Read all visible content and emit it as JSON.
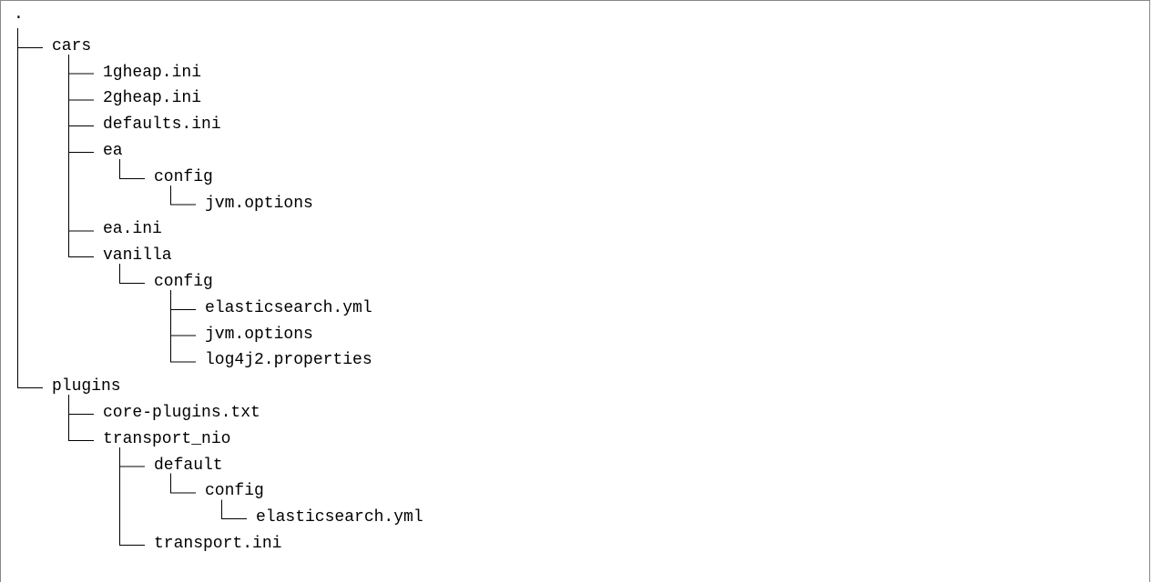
{
  "tree": {
    "root": ".",
    "nodes": [
      {
        "label": "cars",
        "depth": 1,
        "last": false
      },
      {
        "label": "1gheap.ini",
        "depth": 2,
        "last": false
      },
      {
        "label": "2gheap.ini",
        "depth": 2,
        "last": false
      },
      {
        "label": "defaults.ini",
        "depth": 2,
        "last": false
      },
      {
        "label": "ea",
        "depth": 2,
        "last": false
      },
      {
        "label": "config",
        "depth": 3,
        "last": true
      },
      {
        "label": "jvm.options",
        "depth": 4,
        "last": true
      },
      {
        "label": "ea.ini",
        "depth": 2,
        "last": false
      },
      {
        "label": "vanilla",
        "depth": 2,
        "last": true
      },
      {
        "label": "config",
        "depth": 3,
        "last": true
      },
      {
        "label": "elasticsearch.yml",
        "depth": 4,
        "last": false
      },
      {
        "label": "jvm.options",
        "depth": 4,
        "last": false
      },
      {
        "label": "log4j2.properties",
        "depth": 4,
        "last": true
      },
      {
        "label": "plugins",
        "depth": 1,
        "last": true
      },
      {
        "label": "core-plugins.txt",
        "depth": 2,
        "last": false
      },
      {
        "label": "transport_nio",
        "depth": 2,
        "last": true
      },
      {
        "label": "default",
        "depth": 3,
        "last": false
      },
      {
        "label": "config",
        "depth": 4,
        "last": true
      },
      {
        "label": "elasticsearch.yml",
        "depth": 5,
        "last": true
      },
      {
        "label": "transport.ini",
        "depth": 3,
        "last": true
      }
    ]
  }
}
